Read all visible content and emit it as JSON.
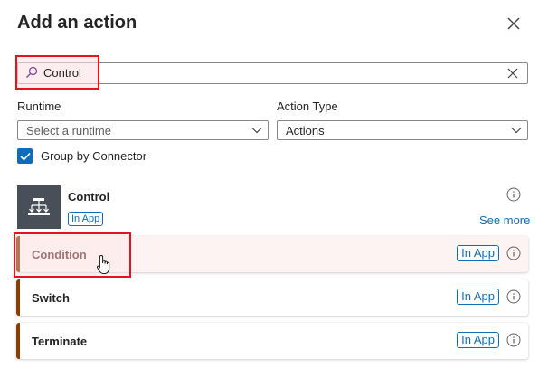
{
  "panel": {
    "title": "Add an action"
  },
  "search": {
    "value": "Control"
  },
  "filters": {
    "runtime_label": "Runtime",
    "runtime_value": "Select a runtime",
    "action_type_label": "Action Type",
    "action_type_value": "Actions"
  },
  "group_by": {
    "label": "Group by Connector",
    "checked": true
  },
  "connector": {
    "name": "Control",
    "badge": "In App",
    "see_more": "See more",
    "icon": "control-flow-icon"
  },
  "actions": [
    {
      "label": "Condition",
      "badge": "In App",
      "highlighted": true
    },
    {
      "label": "Switch",
      "badge": "In App"
    },
    {
      "label": "Terminate",
      "badge": "In App"
    }
  ],
  "colors": {
    "accent_blue": "#0f6cbd",
    "highlight_red": "#e3141f",
    "action_accent": "#8a3e06",
    "connector_bg": "#484f58"
  }
}
